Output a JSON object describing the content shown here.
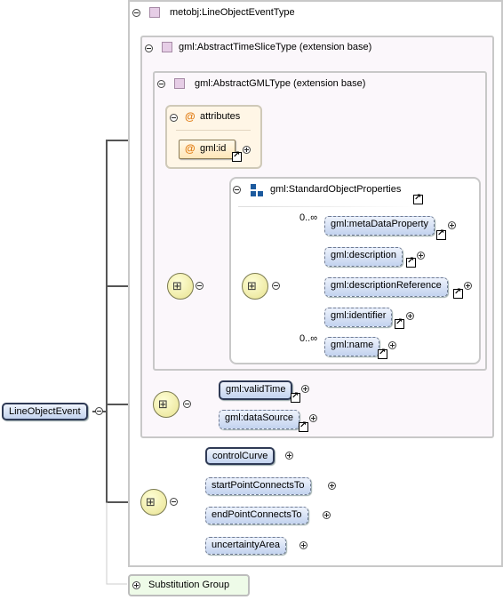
{
  "root": {
    "label": "LineObjectEvent"
  },
  "type": {
    "label": "metobj:LineObjectEventType"
  },
  "ext1": {
    "label": "gml:AbstractTimeSliceType (extension base)"
  },
  "ext2": {
    "label": "gml:AbstractGMLType (extension base)"
  },
  "attributes": {
    "label": "attributes",
    "items": [
      "gml:id"
    ]
  },
  "group": {
    "label": "gml:StandardObjectProperties"
  },
  "group_elements": [
    {
      "label": "gml:metaDataProperty",
      "occurs": "0..∞"
    },
    {
      "label": "gml:description"
    },
    {
      "label": "gml:descriptionReference"
    },
    {
      "label": "gml:identifier"
    },
    {
      "label": "gml:name",
      "occurs": "0..∞"
    }
  ],
  "timeslice_elements": [
    {
      "label": "gml:validTime"
    },
    {
      "label": "gml:dataSource"
    }
  ],
  "own_elements": [
    {
      "label": "controlCurve"
    },
    {
      "label": "startPointConnectsTo"
    },
    {
      "label": "endPointConnectsTo"
    },
    {
      "label": "uncertaintyArea"
    }
  ],
  "substitution": {
    "label": "Substitution Group"
  }
}
